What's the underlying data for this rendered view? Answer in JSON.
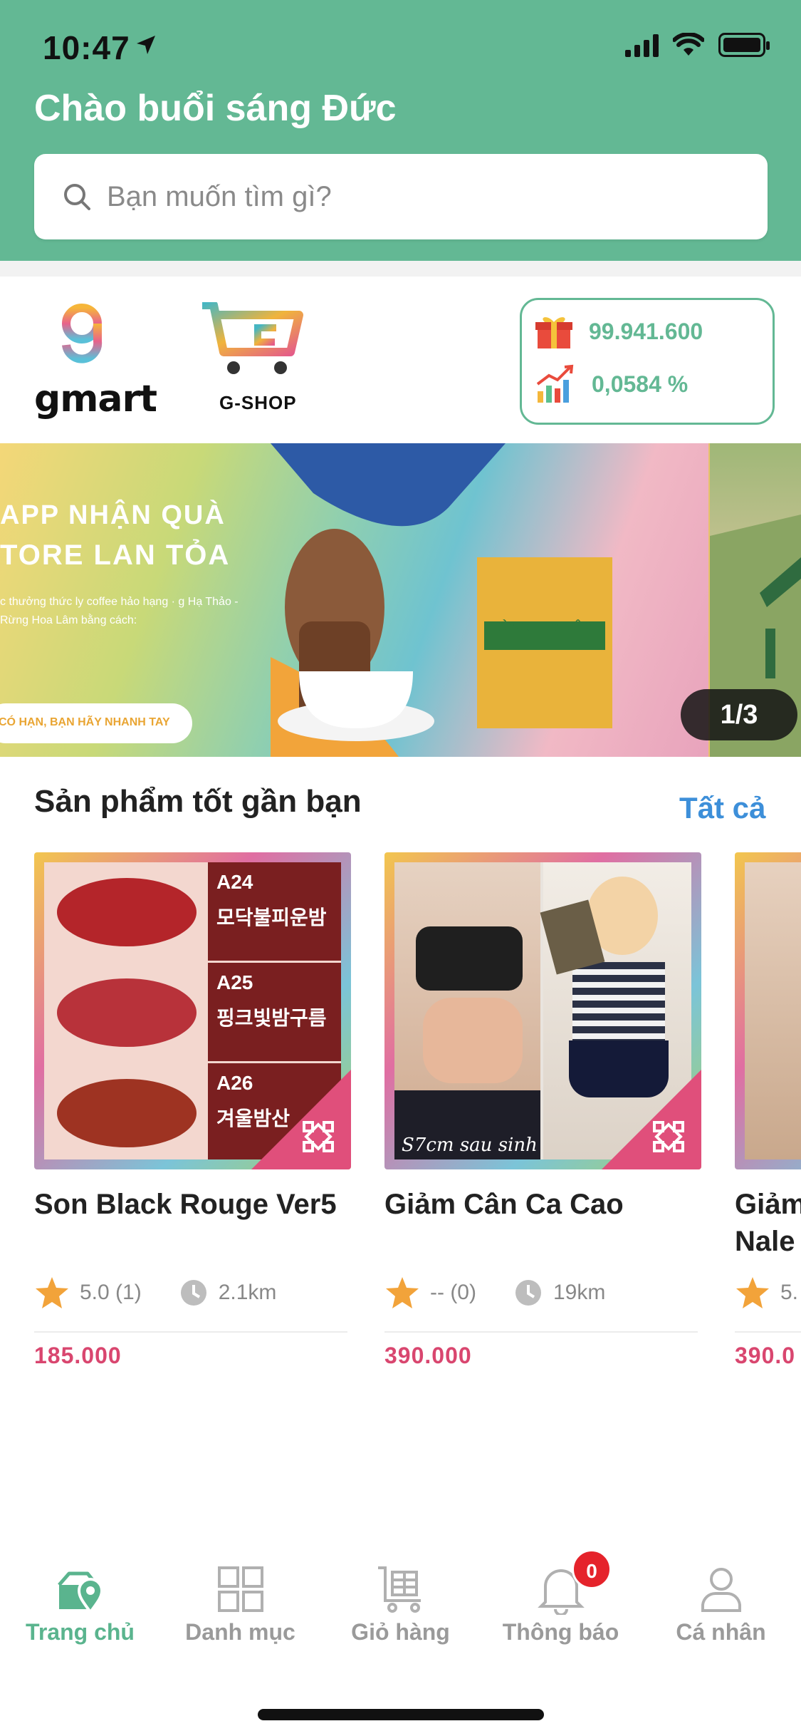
{
  "status_bar": {
    "time": "10:47"
  },
  "header": {
    "greeting_prefix": "Chào buổi sáng",
    "greeting_name": "Đức",
    "search_placeholder": "Bạn muốn tìm gì?"
  },
  "partners": {
    "gmart_label": "gmart",
    "gshop_label": "G-SHOP"
  },
  "wallet": {
    "balance": "99.941.600",
    "rate": "0,0584 %"
  },
  "banner": {
    "line1": "APP NHẬN QUÀ",
    "line2": "TORE LAN TỎA",
    "small_text": "c thưởng thức ly coffee hảo hạng · g Hạ Thảo - Rừng Hoa Lâm bằng cách:",
    "pill_text": "CÓ HẠN, BẠN HÃY NHANH TAY",
    "package_text": "RỪNG HOA LÂM",
    "pager": "1/3"
  },
  "section": {
    "title": "Sản phẩm tốt gần bạn",
    "all_label": "Tất cả"
  },
  "products": [
    {
      "name": "Son Black Rouge Ver5",
      "rating": "5.0 (1)",
      "distance": "2.1km",
      "price": "185.000",
      "shades": [
        {
          "code": "A24",
          "label": "모닥불피운밤"
        },
        {
          "code": "A25",
          "label": "핑크빛밤구름"
        },
        {
          "code": "A26",
          "label": "겨울밤산"
        }
      ]
    },
    {
      "name": "Giảm Cân Ca Cao",
      "rating": "-- (0)",
      "distance": "19km",
      "price": "390.000",
      "image_caption": "S7cm sau sinh"
    },
    {
      "name": "Giảm Nale",
      "rating": "5.",
      "price": "390.0"
    }
  ],
  "nav": [
    {
      "label": "Trang chủ",
      "icon": "home-pin-icon",
      "active": true
    },
    {
      "label": "Danh mục",
      "icon": "grid-icon"
    },
    {
      "label": "Giỏ hàng",
      "icon": "cart-icon"
    },
    {
      "label": "Thông báo",
      "icon": "bell-icon",
      "badge": "0"
    },
    {
      "label": "Cá nhân",
      "icon": "person-icon"
    }
  ],
  "colors": {
    "header": "#63b894",
    "accent_link": "#3d8fd9",
    "price": "#d9466f",
    "badge": "#e5232b"
  }
}
